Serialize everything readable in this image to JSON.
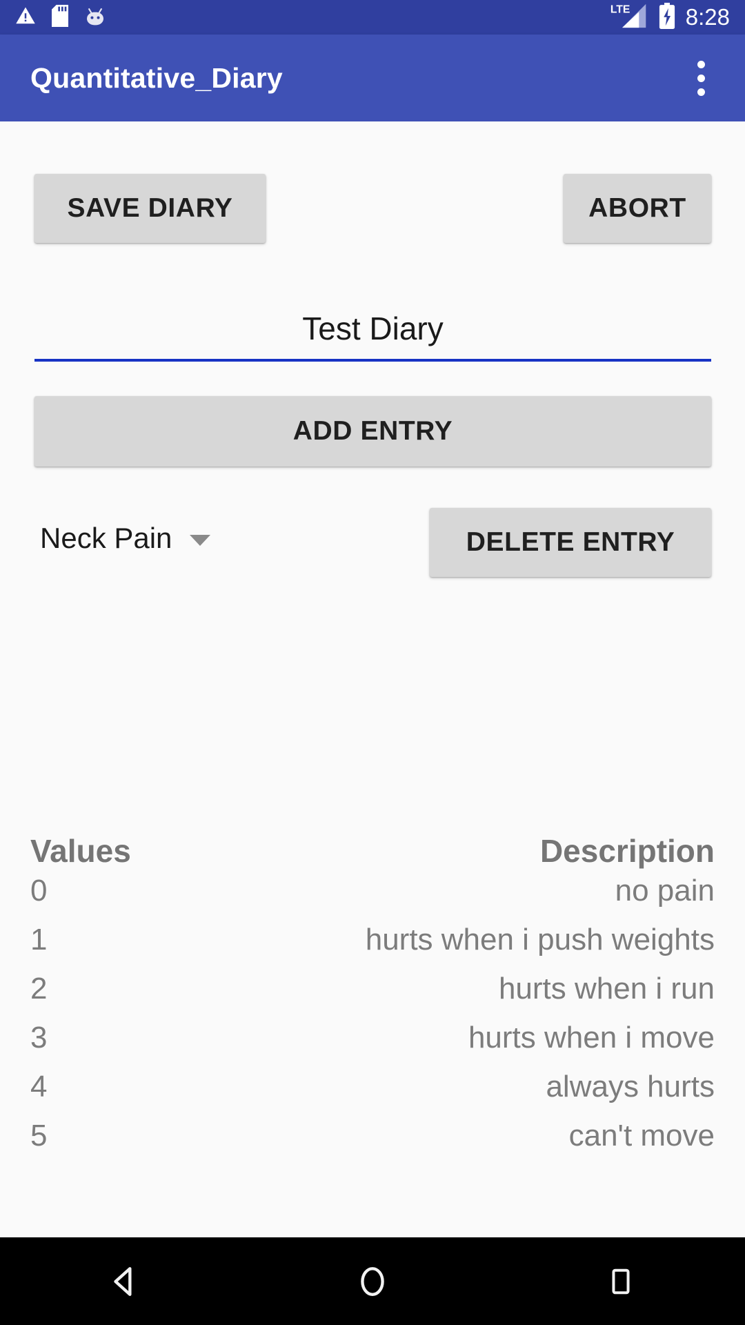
{
  "status_bar": {
    "icons": [
      "warning-triangle-icon",
      "sd-card-icon",
      "android-head-icon"
    ],
    "network_label": "LTE",
    "signal_icon": "signal-bars-icon",
    "battery_icon": "battery-charging-icon",
    "clock": "8:28",
    "background_color": "#303f9f"
  },
  "app_bar": {
    "title": "Quantitative_Diary",
    "overflow_icon": "more-vertical-icon",
    "background_color": "#3f51b5",
    "text_color": "#ffffff"
  },
  "actions": {
    "save_diary_label": "SAVE DIARY",
    "abort_label": "ABORT",
    "add_entry_label": "ADD ENTRY",
    "delete_entry_label": "DELETE ENTRY"
  },
  "diary_title_field": {
    "value": "Test Diary",
    "placeholder": "Test Diary",
    "underline_color": "#1733c4"
  },
  "entry_spinner": {
    "selected": "Neck Pain",
    "caret_icon": "chevron-down-icon"
  },
  "table": {
    "headers": {
      "values": "Values",
      "description": "Description"
    },
    "rows": [
      {
        "value": "0",
        "description": "no pain"
      },
      {
        "value": "1",
        "description": "hurts when i push weights"
      },
      {
        "value": "2",
        "description": "hurts when i run"
      },
      {
        "value": "3",
        "description": "hurts when i move"
      },
      {
        "value": "4",
        "description": "always hurts"
      },
      {
        "value": "5",
        "description": "can't move"
      }
    ]
  },
  "nav_bar": {
    "back": "back-triangle-icon",
    "home": "home-circle-icon",
    "recents": "recents-square-icon",
    "background_color": "#000000"
  }
}
